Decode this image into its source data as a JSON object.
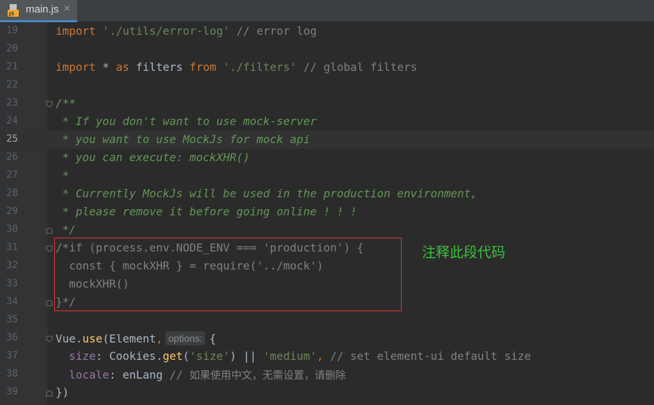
{
  "tab": {
    "title": "main.js",
    "icon_text": "JS",
    "close": "×"
  },
  "lines": [
    {
      "n": "19"
    },
    {
      "n": "20"
    },
    {
      "n": "21"
    },
    {
      "n": "22"
    },
    {
      "n": "23"
    },
    {
      "n": "24"
    },
    {
      "n": "25"
    },
    {
      "n": "26"
    },
    {
      "n": "27"
    },
    {
      "n": "28"
    },
    {
      "n": "29"
    },
    {
      "n": "30"
    },
    {
      "n": "31"
    },
    {
      "n": "32"
    },
    {
      "n": "33"
    },
    {
      "n": "34"
    },
    {
      "n": "35"
    },
    {
      "n": "36"
    },
    {
      "n": "37"
    },
    {
      "n": "38"
    },
    {
      "n": "39"
    }
  ],
  "code": {
    "l19": {
      "kw": "import",
      "s1": " ",
      "str": "'./utils/error-log'",
      "s2": " ",
      "cmt": "// error log"
    },
    "l21": {
      "kw1": "import",
      "t1": " * ",
      "kw2": "as",
      "t2": " filters ",
      "kw3": "from",
      "s1": " ",
      "str": "'./filters'",
      "s2": " ",
      "cmt": "// global filters"
    },
    "l23": "/**",
    "l24": " * If you don't want to use mock-server",
    "l25": " * you want to use MockJs for mock api",
    "l26": " * you can execute: mockXHR()",
    "l27": " *",
    "l28": " * Currently MockJs will be used in the production environment,",
    "l29": " * please remove it before going online ! ! !",
    "l30": " */",
    "l31": "/*if (process.env.NODE_ENV === 'production') {",
    "l32": "  const { mockXHR } = require('../mock')",
    "l33": "  mockXHR()",
    "l34": "}*/",
    "l36": {
      "t1": "Vue.",
      "fn": "use",
      "t2": "(Element",
      "comma": ",",
      "hint": "options:",
      "t3": "{"
    },
    "l37": {
      "indent": "  ",
      "prop": "size",
      "t1": ": Cookies.",
      "fn": "get",
      "t2": "(",
      "str1": "'size'",
      "t3": ") || ",
      "str2": "'medium'",
      "comma": ",",
      "s1": " ",
      "cmt": "// set element-ui default size"
    },
    "l38": {
      "indent": "  ",
      "prop": "locale",
      "t1": ": enLang ",
      "cmt": "// ",
      "cmt_cjk": "如果使用中文，无需设置，请删除"
    },
    "l39": "})"
  },
  "annotation": "注释此段代码",
  "colors": {
    "accent": "#4a88c7",
    "highlight_border": "#e53935",
    "annotation": "#3cc13c"
  }
}
